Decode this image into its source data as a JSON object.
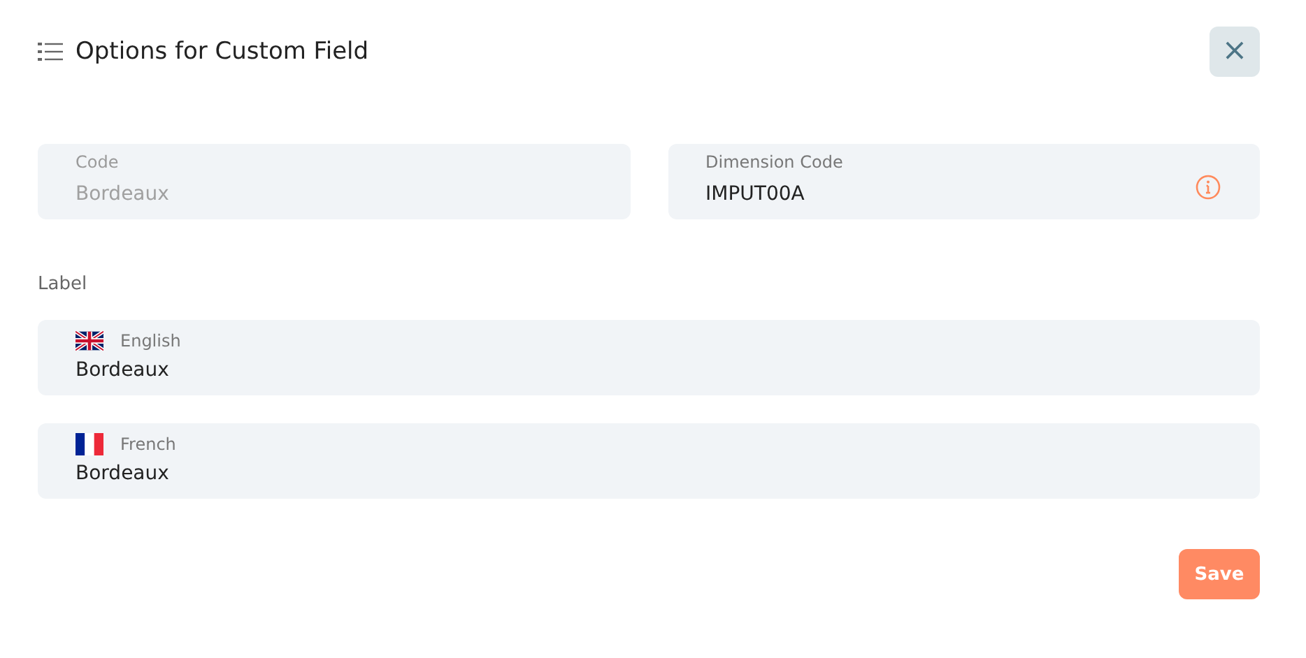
{
  "dialog": {
    "title": "Options for Custom Field",
    "close": "×"
  },
  "fields": [
    {
      "label": "Code",
      "value": "Bordeaux",
      "disabled": true,
      "info": false
    },
    {
      "label": "Dimension Code",
      "value": "IMPUT00A",
      "disabled": false,
      "info": true
    }
  ],
  "label_section": {
    "heading": "Label",
    "languages": [
      {
        "kind": "uk",
        "label": "English",
        "value": "Bordeaux"
      },
      {
        "kind": "fr",
        "label": "French",
        "value": "Bordeaux"
      }
    ]
  },
  "save_button": "Save"
}
